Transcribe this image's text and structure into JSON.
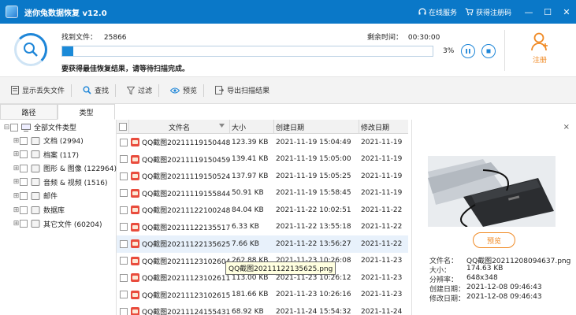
{
  "app": {
    "title": "迷你兔数据恢复 v12.0",
    "service_label": "在线服务",
    "regcode_label": "获得注册码"
  },
  "window": {
    "minimize": "—",
    "maximize": "☐",
    "close": "✕"
  },
  "scan": {
    "found_label": "找到文件：",
    "found_count": "25866",
    "remaining_label": "剩余时间：",
    "remaining_time": "00:30:00",
    "progress_percent": 3,
    "progress_text": "3%",
    "message": "要获得最佳恢复结果，请等待扫描完成。",
    "register_label": "注册"
  },
  "toolbar": {
    "show_lost": "显示丢失文件",
    "find": "查找",
    "filter": "过滤",
    "preview": "预览",
    "export": "导出扫描结果"
  },
  "tabs": [
    {
      "label": "路径"
    },
    {
      "label": "类型"
    }
  ],
  "tree": {
    "root": "全部文件类型",
    "items": [
      {
        "label": "文档 (2994)",
        "icon": "document-icon"
      },
      {
        "label": "档案 (117)",
        "icon": "archive-icon"
      },
      {
        "label": "图形 & 图像 (122964)",
        "icon": "image-icon"
      },
      {
        "label": "音频 & 视频 (1516)",
        "icon": "media-icon"
      },
      {
        "label": "邮件",
        "icon": "mail-icon"
      },
      {
        "label": "数据库",
        "icon": "database-icon"
      },
      {
        "label": "其它文件 (60204)",
        "icon": "folder-icon"
      }
    ]
  },
  "table": {
    "headers": {
      "name": "文件名",
      "size": "大小",
      "created": "创建日期",
      "modified": "修改日期"
    },
    "rows": [
      {
        "name": "QQ截图20211119150448....",
        "size": "123.39 KB",
        "created": "2021-11-19 15:04:49",
        "modified": "2021-11-19"
      },
      {
        "name": "QQ截图20211119150459....",
        "size": "139.41 KB",
        "created": "2021-11-19 15:05:00",
        "modified": "2021-11-19"
      },
      {
        "name": "QQ截图20211119150524....",
        "size": "137.97 KB",
        "created": "2021-11-19 15:05:25",
        "modified": "2021-11-19"
      },
      {
        "name": "QQ截图20211119155844....",
        "size": "50.91 KB",
        "created": "2021-11-19 15:58:45",
        "modified": "2021-11-19"
      },
      {
        "name": "QQ截图20211122100248....",
        "size": "84.04 KB",
        "created": "2021-11-22 10:02:51",
        "modified": "2021-11-22"
      },
      {
        "name": "QQ截图20211122135517....",
        "size": "6.33 KB",
        "created": "2021-11-22 13:55:18",
        "modified": "2021-11-22"
      },
      {
        "name": "QQ截图20211122135625....",
        "size": "7.66 KB",
        "created": "2021-11-22 13:56:27",
        "modified": "2021-11-22"
      },
      {
        "name": "QQ截图20211123102604....",
        "size": "262.88 KB",
        "created": "2021-11-23 10:26:08",
        "modified": "2021-11-23"
      },
      {
        "name": "QQ截图20211123102611....",
        "size": "113.00 KB",
        "created": "2021-11-23 10:26:12",
        "modified": "2021-11-23"
      },
      {
        "name": "QQ截图20211123102615....",
        "size": "181.66 KB",
        "created": "2021-11-23 10:26:16",
        "modified": "2021-11-23"
      },
      {
        "name": "QQ截图20211124155431....",
        "size": "68.92 KB",
        "created": "2021-11-24 15:54:32",
        "modified": "2021-11-24"
      }
    ],
    "tooltip": "QQ截图20211122135625.png"
  },
  "preview": {
    "close": "×",
    "button": "预览",
    "meta": [
      {
        "k": "文件名：",
        "v": "QQ截图20211208094637.png"
      },
      {
        "k": "大小：",
        "v": "174.63 KB"
      },
      {
        "k": "分辨率：",
        "v": "648x348"
      },
      {
        "k": "创建日期：",
        "v": "2021-12-08 09:46:43"
      },
      {
        "k": "修改日期：",
        "v": "2021-12-08 09:46:43"
      }
    ]
  },
  "colors": {
    "titlebar": "#0a78c8",
    "accent": "#1e86d8",
    "orange": "#f08a24"
  }
}
